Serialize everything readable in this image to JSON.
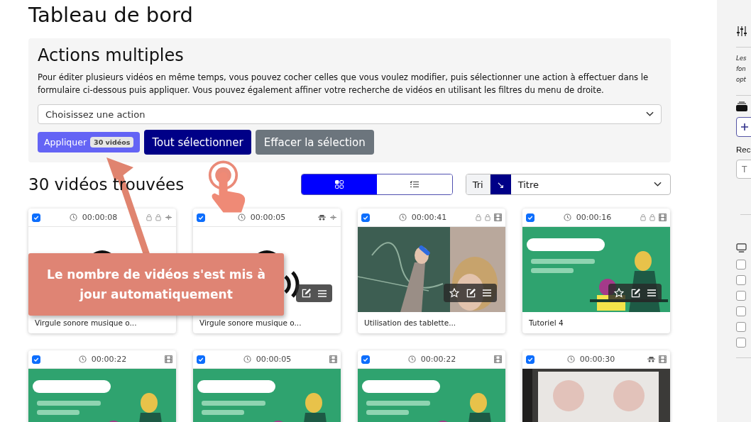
{
  "page_title": "Tableau de bord",
  "bulk_actions": {
    "title": "Actions multiples",
    "description": "Pour éditer plusieurs vidéos en même temps, vous pouvez cocher celles que vous voulez modifier, puis sélectionner une action à effectuer dans le formulaire ci-dessous puis appliquer. Vous pouvez également affiner votre recherche de vidéos en utilisant les filtres du menu de droite.",
    "action_select": {
      "value": "Choisissez une action"
    },
    "buttons": [
      {
        "kind": "apply",
        "label": "Appliquer",
        "badge": "30 vidéos"
      },
      {
        "kind": "select_all",
        "label": "Tout sélectionner"
      },
      {
        "kind": "clear",
        "label": "Effacer la sélection"
      }
    ]
  },
  "results": {
    "count_title": "30 vidéos trouvées",
    "view_modes": [
      {
        "kind": "grid",
        "selected": true
      },
      {
        "kind": "list",
        "selected": false
      }
    ],
    "sort": {
      "label": "Tri",
      "direction": "↘",
      "value": "Titre"
    }
  },
  "videos": [
    {
      "checked": true,
      "duration": "00:00:08",
      "flags": [
        {
          "kind": "lock"
        },
        {
          "kind": "lock"
        },
        {
          "kind": "audio"
        }
      ],
      "title": "Virgule sonore musique o..."
    },
    {
      "checked": true,
      "duration": "00:00:05",
      "flags": [
        {
          "kind": "incognito"
        },
        {
          "kind": "audio"
        }
      ],
      "toolbar": [
        {
          "kind": "edit"
        },
        {
          "kind": "menu"
        }
      ],
      "title": "Virgule sonore musique o..."
    },
    {
      "checked": true,
      "duration": "00:00:41",
      "flags": [
        {
          "kind": "lock"
        },
        {
          "kind": "lock"
        },
        {
          "kind": "film"
        }
      ],
      "toolbar": [
        {
          "kind": "star"
        },
        {
          "kind": "edit"
        },
        {
          "kind": "menu"
        }
      ],
      "title": "Utilisation des tablette..."
    },
    {
      "checked": true,
      "duration": "00:00:16",
      "flags": [
        {
          "kind": "lock"
        },
        {
          "kind": "lock"
        },
        {
          "kind": "film"
        }
      ],
      "toolbar": [
        {
          "kind": "star"
        },
        {
          "kind": "edit"
        },
        {
          "kind": "menu"
        }
      ],
      "title": "Tutoriel 4"
    },
    {
      "checked": true,
      "duration": "00:00:22",
      "flags": [
        {
          "kind": "film"
        }
      ]
    },
    {
      "checked": true,
      "duration": "00:00:05",
      "flags": [
        {
          "kind": "film"
        }
      ]
    },
    {
      "checked": true,
      "duration": "00:00:22",
      "flags": [
        {
          "kind": "film"
        }
      ]
    },
    {
      "checked": true,
      "duration": "00:00:30",
      "flags": [
        {
          "kind": "incognito"
        },
        {
          "kind": "film"
        }
      ]
    }
  ],
  "tutorial": {
    "callout": "Le nombre de vidéos s'est mis à jour automatiquement"
  },
  "sidebar": {
    "intro_lines": [
      "Les",
      "fon",
      "opt"
    ],
    "search_label": "Rec",
    "search_placeholder": "T",
    "checkboxes": [
      {
        "checked": false
      },
      {
        "checked": false
      },
      {
        "checked": false
      },
      {
        "checked": false
      },
      {
        "checked": false
      },
      {
        "checked": false
      }
    ]
  }
}
